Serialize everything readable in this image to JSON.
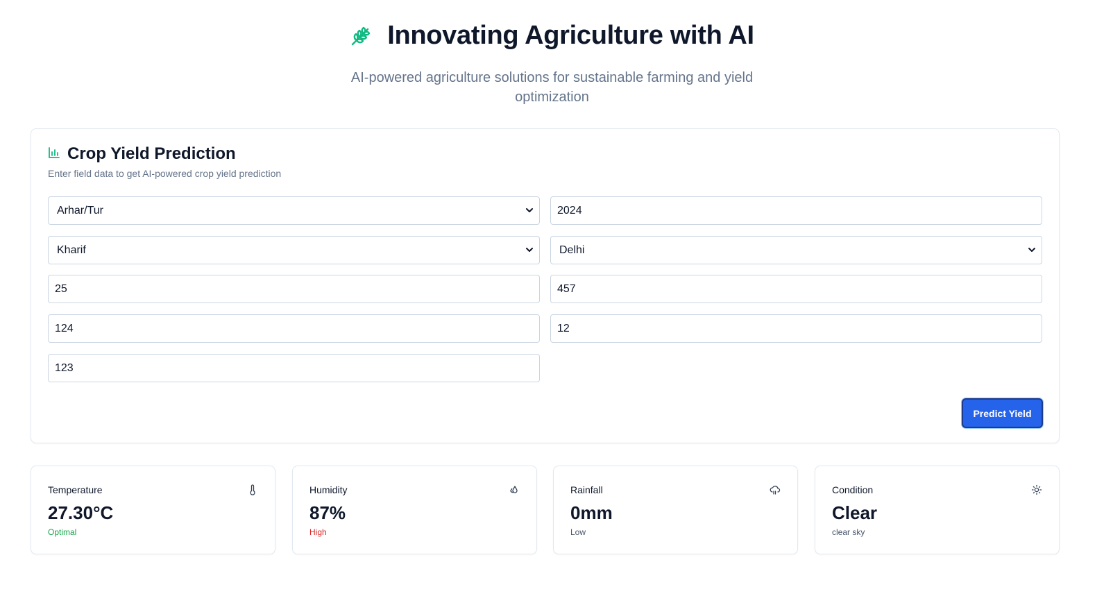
{
  "hero": {
    "title": "Innovating Agriculture with AI",
    "subtitle": "AI-powered agriculture solutions for sustainable farming and yield optimization",
    "icon": "wheat-icon"
  },
  "prediction": {
    "title": "Crop Yield Prediction",
    "description": "Enter field data to get AI-powered crop yield prediction",
    "icon": "bar-chart-icon",
    "fields": {
      "crop": "Arhar/Tur",
      "year": "2024",
      "season": "Kharif",
      "state": "Delhi",
      "field_5": "25",
      "field_6": "457",
      "field_7": "124",
      "field_8": "12",
      "field_9": "123"
    },
    "submit_label": "Predict Yield"
  },
  "weather": [
    {
      "label": "Temperature",
      "value": "27.30°C",
      "note": "Optimal",
      "note_color": "#16a34a",
      "icon": "thermometer-icon"
    },
    {
      "label": "Humidity",
      "value": "87%",
      "note": "High",
      "note_color": "#dc2626",
      "icon": "droplets-icon"
    },
    {
      "label": "Rainfall",
      "value": "0mm",
      "note": "Low",
      "note_color": "#475569",
      "icon": "cloud-rain-icon"
    },
    {
      "label": "Condition",
      "value": "Clear",
      "note": "clear sky",
      "note_color": "#475569",
      "icon": "sun-icon"
    }
  ],
  "colors": {
    "accent": "#10b981",
    "primary": "#2563eb"
  }
}
